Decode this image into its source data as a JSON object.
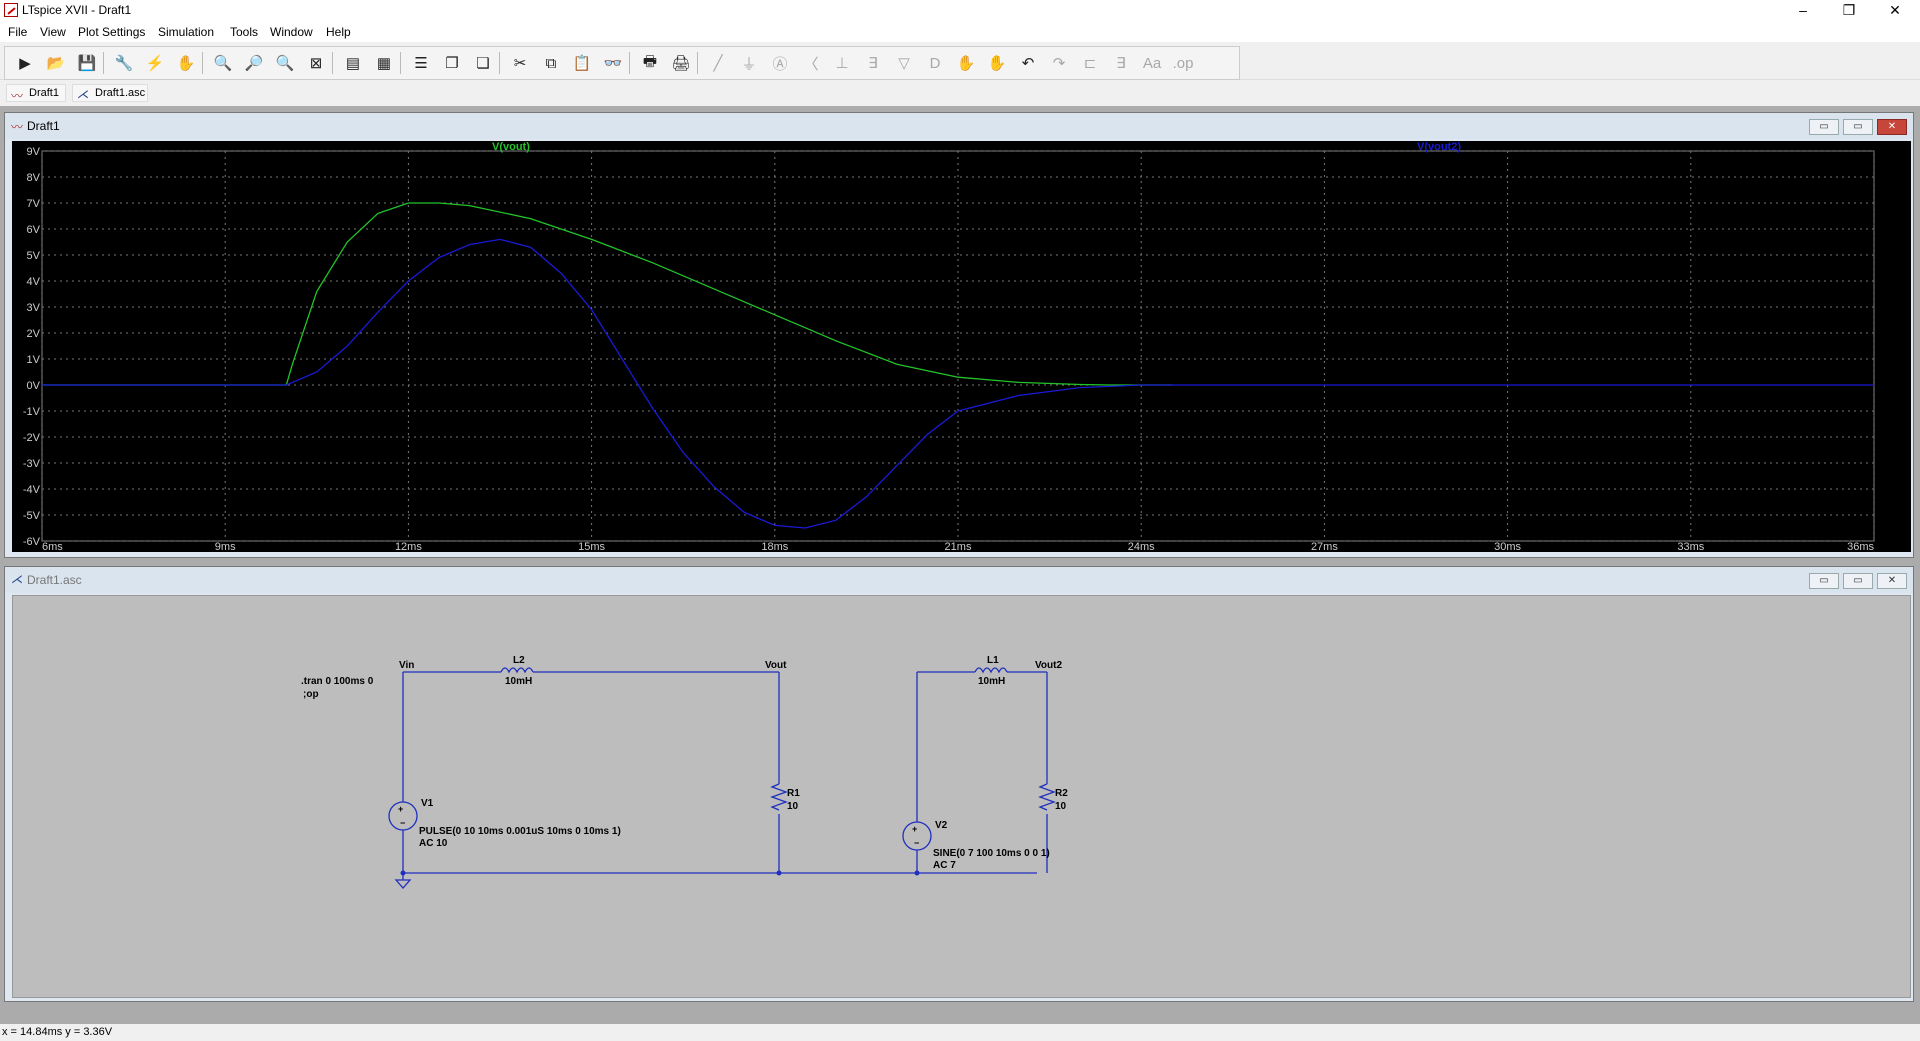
{
  "window": {
    "title": "LTspice XVII - Draft1",
    "minimize": "–",
    "restore": "❐",
    "close": "✕"
  },
  "menu": [
    "File",
    "View",
    "Plot Settings",
    "Simulation",
    "Tools",
    "Window",
    "Help"
  ],
  "toolbar": [
    {
      "icon": "run-icon",
      "glyph": "▶"
    },
    {
      "icon": "open-icon",
      "glyph": "📂"
    },
    {
      "icon": "save-icon",
      "glyph": "💾"
    },
    {
      "icon": "control-panel-icon",
      "glyph": "🔧"
    },
    {
      "icon": "halt-icon",
      "glyph": "⚡"
    },
    {
      "icon": "pan-hand-icon",
      "glyph": "✋"
    },
    {
      "icon": "zoom-in-icon",
      "glyph": "🔍"
    },
    {
      "icon": "zoom-area-icon",
      "glyph": "🔎"
    },
    {
      "icon": "zoom-out-icon",
      "glyph": "🔍"
    },
    {
      "icon": "zoom-fit-icon",
      "glyph": "⊠"
    },
    {
      "icon": "autorange-icon",
      "glyph": "▤"
    },
    {
      "icon": "grid-icon",
      "glyph": "▦"
    },
    {
      "icon": "tile-horizontal-icon",
      "glyph": "☰"
    },
    {
      "icon": "cascade-icon",
      "glyph": "❐"
    },
    {
      "icon": "tile-vertical-icon",
      "glyph": "❏"
    },
    {
      "icon": "cut-icon",
      "glyph": "✂"
    },
    {
      "icon": "copy-icon",
      "glyph": "⧉"
    },
    {
      "icon": "paste-icon",
      "glyph": "📋"
    },
    {
      "icon": "find-icon",
      "glyph": "👓"
    },
    {
      "icon": "print-icon",
      "glyph": "🖶"
    },
    {
      "icon": "print-preview-icon",
      "glyph": "🖨"
    },
    {
      "icon": "wire-icon",
      "glyph": "╱",
      "disabled": true
    },
    {
      "icon": "ground-icon",
      "glyph": "⏚",
      "disabled": true
    },
    {
      "icon": "label-net-icon",
      "glyph": "Ⓐ",
      "disabled": true
    },
    {
      "icon": "resistor-icon",
      "glyph": "〈",
      "disabled": true
    },
    {
      "icon": "capacitor-icon",
      "glyph": "⊥",
      "disabled": true
    },
    {
      "icon": "inductor-icon",
      "glyph": "∃",
      "disabled": true
    },
    {
      "icon": "diode-icon",
      "glyph": "▽",
      "disabled": true
    },
    {
      "icon": "component-icon",
      "glyph": "D",
      "disabled": true
    },
    {
      "icon": "move-icon",
      "glyph": "✋",
      "disabled": true
    },
    {
      "icon": "drag-icon",
      "glyph": "✋",
      "disabled": true
    },
    {
      "icon": "undo-icon",
      "glyph": "↶"
    },
    {
      "icon": "redo-icon",
      "glyph": "↷",
      "disabled": true
    },
    {
      "icon": "rotate-icon",
      "glyph": "⊏",
      "disabled": true
    },
    {
      "icon": "mirror-icon",
      "glyph": "∃",
      "disabled": true
    },
    {
      "icon": "text-icon",
      "glyph": "Aa",
      "disabled": true
    },
    {
      "icon": "spice-directive-icon",
      "glyph": ".op",
      "disabled": true
    }
  ],
  "tabs": [
    {
      "label": "Draft1",
      "icon": "waveform-icon"
    },
    {
      "label": "Draft1.asc",
      "icon": "schematic-icon"
    }
  ],
  "plot_window": {
    "title": "Draft1",
    "btn_min": "▭",
    "btn_max": "▭",
    "btn_close": "✕"
  },
  "schematic_window": {
    "title": "Draft1.asc",
    "btn_min": "▭",
    "btn_max": "▭",
    "btn_close": "✕"
  },
  "chart_data": {
    "type": "line",
    "xlabel": "",
    "ylabel": "",
    "xlim": [
      6,
      36
    ],
    "ylim": [
      -6,
      9
    ],
    "x_ticks": [
      "6ms",
      "9ms",
      "12ms",
      "15ms",
      "18ms",
      "21ms",
      "24ms",
      "27ms",
      "30ms",
      "33ms",
      "36ms"
    ],
    "y_ticks": [
      "9V",
      "8V",
      "7V",
      "6V",
      "5V",
      "4V",
      "3V",
      "2V",
      "1V",
      "0V",
      "-1V",
      "-2V",
      "-3V",
      "-4V",
      "-5V",
      "-6V"
    ],
    "grid": true,
    "series": [
      {
        "name": "V(vout)",
        "color": "#22c42a",
        "x": [
          6,
          10,
          10.1,
          10.5,
          11,
          11.5,
          12,
          12.5,
          13,
          14,
          15,
          16,
          17,
          18,
          19,
          20,
          21,
          22,
          23,
          23.5,
          24,
          24.5
        ],
        "y": [
          0,
          0,
          0.8,
          3.6,
          5.5,
          6.6,
          7.0,
          7.0,
          6.9,
          6.4,
          5.6,
          4.7,
          3.7,
          2.7,
          1.7,
          0.8,
          0.3,
          0.1,
          0.02,
          0,
          0,
          0
        ]
      },
      {
        "name": "V(vout2)",
        "color": "#1a1ad6",
        "x": [
          6,
          10,
          10.5,
          11,
          11.5,
          12,
          12.5,
          13,
          13.5,
          14,
          14.5,
          15,
          15.5,
          16,
          16.5,
          17,
          17.5,
          18,
          18.5,
          19,
          19.5,
          20,
          20.5,
          21,
          22,
          23,
          24,
          36
        ],
        "y": [
          0,
          0,
          0.5,
          1.5,
          2.8,
          4.0,
          4.9,
          5.4,
          5.6,
          5.3,
          4.3,
          2.9,
          1.0,
          -0.9,
          -2.6,
          -3.9,
          -4.9,
          -5.4,
          -5.5,
          -5.2,
          -4.3,
          -3.1,
          -1.9,
          -1.0,
          -0.4,
          -0.1,
          0,
          0
        ]
      }
    ]
  },
  "schematic": {
    "directive_tran": ".tran 0 100ms 0",
    "directive_op": ";op",
    "nodes": {
      "vin": "Vin",
      "vout": "Vout",
      "vout2": "Vout2"
    },
    "L2": {
      "ref": "L2",
      "value": "10mH"
    },
    "L1": {
      "ref": "L1",
      "value": "10mH"
    },
    "R1": {
      "ref": "R1",
      "value": "10"
    },
    "R2": {
      "ref": "R2",
      "value": "10"
    },
    "V1": {
      "ref": "V1",
      "spec": "PULSE(0 10 10ms 0.001uS 10ms 0 10ms 1)",
      "ac": "AC 10"
    },
    "V2": {
      "ref": "V2",
      "spec": "SINE(0 7 100 10ms 0 0 1)",
      "ac": "AC 7"
    }
  },
  "status": {
    "coords": "x = 14.84ms   y = 3.36V"
  }
}
